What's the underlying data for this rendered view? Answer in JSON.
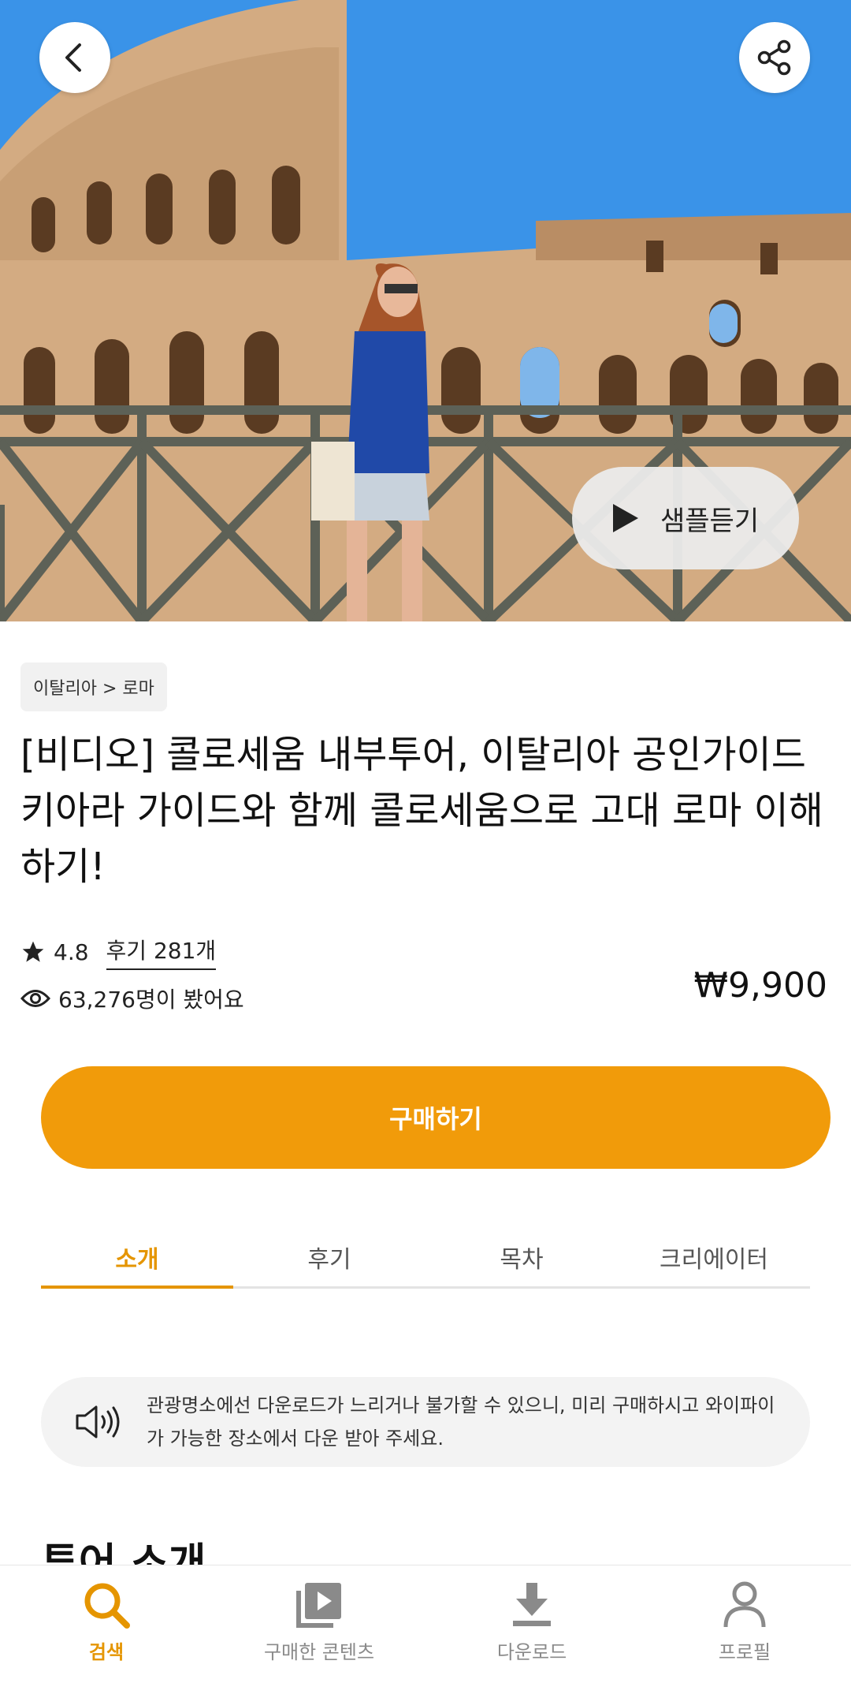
{
  "header": {
    "back_icon": "chevron-left-icon",
    "share_icon": "share-icon",
    "sample_label": "샘플듣기"
  },
  "product": {
    "breadcrumb": "이탈리아 > 로마",
    "title": "[비디오] 콜로세움 내부투어, 이탈리아 공인가이드 키아라 가이드와 함께 콜로세움으로 고대 로마 이해하기!",
    "rating": "4.8",
    "reviews": "후기 281개",
    "views": "63,276명이 봤어요",
    "price": "₩9,900",
    "buy_label": "구매하기"
  },
  "tabs": [
    {
      "label": "소개",
      "active": true
    },
    {
      "label": "후기",
      "active": false
    },
    {
      "label": "목차",
      "active": false
    },
    {
      "label": "크리에이터",
      "active": false
    }
  ],
  "notice": {
    "icon": "speaker-icon",
    "text": "관광명소에선 다운로드가 느리거나 불가할 수 있으니, 미리 구매하시고 와이파이가 가능한 장소에서 다운 받아 주세요."
  },
  "section": {
    "title": "투어 소개"
  },
  "bottom_nav": [
    {
      "label": "검색",
      "icon": "search-icon",
      "active": true
    },
    {
      "label": "구매한 콘텐츠",
      "icon": "video-library-icon",
      "active": false
    },
    {
      "label": "다운로드",
      "icon": "download-icon",
      "active": false
    },
    {
      "label": "프로필",
      "icon": "profile-icon",
      "active": false
    }
  ],
  "colors": {
    "accent": "#f19b0a",
    "active_tab": "#e59500",
    "sky": "#2f8be6"
  }
}
